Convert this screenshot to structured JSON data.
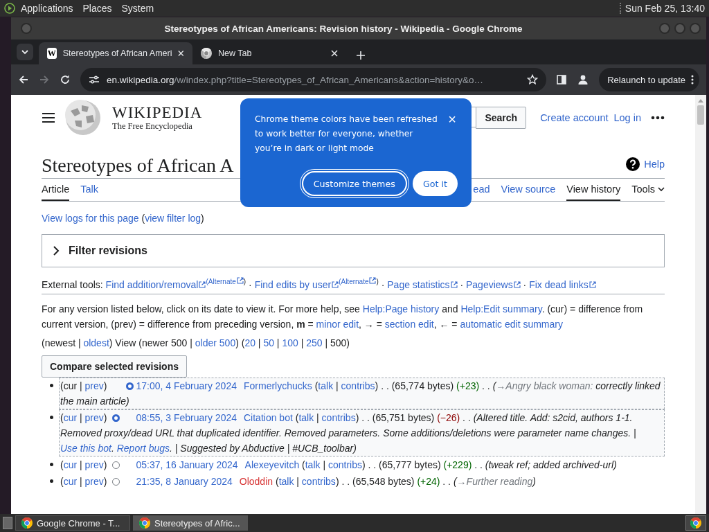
{
  "top_panel": {
    "menus": [
      "Applications",
      "Places",
      "System"
    ],
    "clock": "Sun Feb 25, 13:40"
  },
  "window": {
    "title": "Stereotypes of African Americans: Revision history - Wikipedia - Google Chrome"
  },
  "tabs": [
    {
      "label": "Stereotypes of African Ameri",
      "favicon": "W",
      "kind": "wiki",
      "selected": true
    },
    {
      "label": "New Tab",
      "kind": "chrome",
      "selected": false
    }
  ],
  "toolbar": {
    "url_host": "en.wikipedia.org",
    "url_rest": "/w/index.php?title=Stereotypes_of_African_Americans&action=history&o…",
    "forward_disabled": true,
    "relaunch": "Relaunch to update"
  },
  "page": {
    "wordmark": "WIKIPEDIA",
    "tagline": "The Free Encyclopedia",
    "search_button": "Search",
    "user_links": [
      "Create account",
      "Log in"
    ],
    "title": "Stereotypes of African A",
    "help": "Help",
    "left_tabs": [
      {
        "label": "Article",
        "kind": "tab",
        "selected": true
      },
      {
        "label": "Talk",
        "kind": "tab",
        "selected": false
      }
    ],
    "right_tabs": [
      {
        "label": "ead",
        "kind": "tab",
        "selected": false
      },
      {
        "label": "View source",
        "kind": "tab",
        "selected": false
      },
      {
        "label": "View history",
        "kind": "tab",
        "selected": true
      },
      {
        "label": "Tools",
        "kind": "menu",
        "selected": false
      }
    ],
    "logs_line": [
      {
        "kind": "link",
        "text": "View logs for this page"
      },
      {
        "kind": "text",
        "text": " ("
      },
      {
        "kind": "link",
        "text": "view filter log"
      },
      {
        "kind": "text",
        "text": ")"
      }
    ],
    "filter": {
      "label": "Filter revisions",
      "expanded": false
    },
    "external_tools": [
      {
        "kind": "text",
        "text": "External tools: "
      },
      {
        "kind": "ext",
        "text": "Find addition/removal"
      },
      {
        "kind": "alt",
        "text": "(Alternate",
        "after": ")"
      },
      {
        "kind": "text",
        "text": " · "
      },
      {
        "kind": "ext",
        "text": "Find edits by user"
      },
      {
        "kind": "alt",
        "text": "(Alternate",
        "after": ")"
      },
      {
        "kind": "text",
        "text": " · "
      },
      {
        "kind": "ext",
        "text": "Page statistics"
      },
      {
        "kind": "text",
        "text": " · "
      },
      {
        "kind": "ext",
        "text": "Pageviews"
      },
      {
        "kind": "text",
        "text": " · "
      },
      {
        "kind": "ext",
        "text": "Fix dead links"
      }
    ],
    "help_text": [
      {
        "kind": "text",
        "text": "For any version listed below, click on its date to view it. For more help, see "
      },
      {
        "kind": "link",
        "text": "Help:Page history"
      },
      {
        "kind": "text",
        "text": " and "
      },
      {
        "kind": "link",
        "text": "Help:Edit summary"
      },
      {
        "kind": "text",
        "text": ". (cur) = difference from current version, (prev) = difference from preceding version, "
      },
      {
        "kind": "bold",
        "text": "m"
      },
      {
        "kind": "text",
        "text": " = "
      },
      {
        "kind": "link",
        "text": "minor edit"
      },
      {
        "kind": "text",
        "text": ", → = "
      },
      {
        "kind": "link",
        "text": "section edit"
      },
      {
        "kind": "text",
        "text": ", ← = "
      },
      {
        "kind": "link",
        "text": "automatic edit summary"
      }
    ],
    "pagination": [
      {
        "kind": "text",
        "text": "(newest | "
      },
      {
        "kind": "link",
        "text": "oldest"
      },
      {
        "kind": "text",
        "text": ") View (newer 500 | "
      },
      {
        "kind": "link",
        "text": "older 500"
      },
      {
        "kind": "text",
        "text": ") ("
      },
      {
        "kind": "link",
        "text": "20"
      },
      {
        "kind": "text",
        "text": " | "
      },
      {
        "kind": "link",
        "text": "50"
      },
      {
        "kind": "text",
        "text": " | "
      },
      {
        "kind": "link",
        "text": "100"
      },
      {
        "kind": "text",
        "text": " | "
      },
      {
        "kind": "link",
        "text": "250"
      },
      {
        "kind": "text",
        "text": " | 500)"
      }
    ],
    "compare_button": "Compare selected revisions",
    "revisions": [
      {
        "selected": true,
        "segments": [
          {
            "kind": "text",
            "text": "(cur | "
          },
          {
            "kind": "link",
            "text": "prev"
          },
          {
            "kind": "text",
            "text": ")"
          },
          {
            "kind": "radio_diff",
            "checked": true
          },
          {
            "kind": "date",
            "text": "17:00, 4 February 2024"
          },
          {
            "kind": "link",
            "text": "Formerlychucks"
          },
          {
            "kind": "text",
            "text": " ("
          },
          {
            "kind": "link",
            "text": "talk"
          },
          {
            "kind": "text",
            "text": " | "
          },
          {
            "kind": "link",
            "text": "contribs"
          },
          {
            "kind": "text",
            "text": ")  . . (65,774 bytes) "
          },
          {
            "kind": "plus",
            "text": "(+23)"
          },
          {
            "kind": "text",
            "text": " . . "
          },
          {
            "kind": "italic",
            "text": "("
          },
          {
            "kind": "section",
            "text": "→Angry black woman:"
          },
          {
            "kind": "italic",
            "text": " correctly linked the main article)"
          }
        ]
      },
      {
        "selected": true,
        "segments": [
          {
            "kind": "text",
            "text": "("
          },
          {
            "kind": "link",
            "text": "cur"
          },
          {
            "kind": "text",
            "text": " | "
          },
          {
            "kind": "link",
            "text": "prev"
          },
          {
            "kind": "text",
            "text": ")"
          },
          {
            "kind": "radio_oldid",
            "checked": true
          },
          {
            "kind": "date",
            "text": "08:55, 3 February 2024"
          },
          {
            "kind": "link",
            "text": "Citation bot"
          },
          {
            "kind": "text",
            "text": " ("
          },
          {
            "kind": "link",
            "text": "talk"
          },
          {
            "kind": "text",
            "text": " | "
          },
          {
            "kind": "link",
            "text": "contribs"
          },
          {
            "kind": "text",
            "text": ")  . . (65,751 bytes) "
          },
          {
            "kind": "minus",
            "text": "(−26)"
          },
          {
            "kind": "text",
            "text": " . . "
          },
          {
            "kind": "italic",
            "text": "(Altered title. Add: s2cid, authors 1-1. Removed proxy/dead URL that duplicated identifier. Removed parameters. Some additions/deletions were parameter name changes. | "
          },
          {
            "kind": "ilink",
            "text": "Use this bot"
          },
          {
            "kind": "italic",
            "text": ". "
          },
          {
            "kind": "ilink",
            "text": "Report bugs"
          },
          {
            "kind": "italic",
            "text": ". | Suggested by Abductive | #UCB_toolbar)"
          }
        ]
      },
      {
        "selected": false,
        "segments": [
          {
            "kind": "text",
            "text": "("
          },
          {
            "kind": "link",
            "text": "cur"
          },
          {
            "kind": "text",
            "text": " | "
          },
          {
            "kind": "link",
            "text": "prev"
          },
          {
            "kind": "text",
            "text": ")"
          },
          {
            "kind": "radio_oldid",
            "checked": false
          },
          {
            "kind": "date",
            "text": "05:37, 16 January 2024"
          },
          {
            "kind": "link",
            "text": "Alexeyevitch"
          },
          {
            "kind": "text",
            "text": " ("
          },
          {
            "kind": "link",
            "text": "talk"
          },
          {
            "kind": "text",
            "text": " | "
          },
          {
            "kind": "link",
            "text": "contribs"
          },
          {
            "kind": "text",
            "text": ")  . . (65,777 bytes) "
          },
          {
            "kind": "plus",
            "text": "(+229)"
          },
          {
            "kind": "text",
            "text": " . . "
          },
          {
            "kind": "italic",
            "text": "(tweak ref; added archived-url)"
          }
        ]
      },
      {
        "selected": false,
        "segments": [
          {
            "kind": "text",
            "text": "("
          },
          {
            "kind": "link",
            "text": "cur"
          },
          {
            "kind": "text",
            "text": " | "
          },
          {
            "kind": "link",
            "text": "prev"
          },
          {
            "kind": "text",
            "text": ")"
          },
          {
            "kind": "radio_oldid",
            "checked": false
          },
          {
            "kind": "date",
            "text": "21:35, 8 January 2024"
          },
          {
            "kind": "redlink",
            "text": "Oloddin"
          },
          {
            "kind": "text",
            "text": " ("
          },
          {
            "kind": "link",
            "text": "talk"
          },
          {
            "kind": "text",
            "text": " | "
          },
          {
            "kind": "link",
            "text": "contribs"
          },
          {
            "kind": "text",
            "text": ")  . . (65,548 bytes) "
          },
          {
            "kind": "plus",
            "text": "(+24)"
          },
          {
            "kind": "text",
            "text": " . . "
          },
          {
            "kind": "italic",
            "text": "("
          },
          {
            "kind": "section",
            "text": "→Further reading"
          },
          {
            "kind": "italic",
            "text": ")"
          }
        ]
      }
    ]
  },
  "popup": {
    "message": "Chrome theme colors have been refreshed to work better for everyone, whether you’re in dark or light mode",
    "close": "×",
    "buttons": [
      {
        "label": "Customize themes",
        "kind": "outline"
      },
      {
        "label": "Got it",
        "kind": "filled"
      }
    ]
  },
  "taskbar": {
    "tasks": [
      {
        "label": "Google Chrome - T...",
        "selected": false
      },
      {
        "label": "Stereotypes of Afric...",
        "selected": true
      }
    ]
  }
}
